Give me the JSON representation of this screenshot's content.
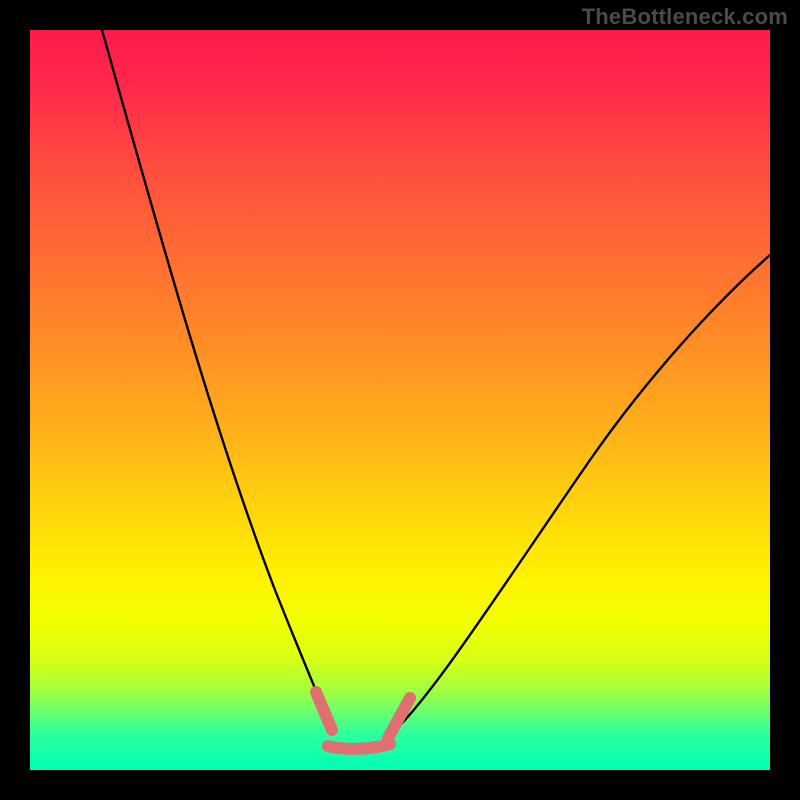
{
  "watermark": "TheBottleneck.com",
  "colors": {
    "page_bg": "#000000",
    "watermark": "#4a4a4a",
    "curve": "#000000",
    "marker": "#e07070",
    "gradient_top": "#ff1a4c",
    "gradient_bottom": "#00ffb4"
  },
  "chart_data": {
    "type": "line",
    "title": "",
    "xlabel": "",
    "ylabel": "",
    "xlim": [
      0,
      100
    ],
    "ylim": [
      0,
      100
    ],
    "grid": false,
    "note": "Axes lack tick labels; values are fractional positions read from pixel geometry. y=0 is bottom (green), y=100 is top (red). The curve is a V-shaped bottleneck profile with its minimum near x≈40–48, y≈4.",
    "series": [
      {
        "name": "bottleneck-curve",
        "x": [
          10,
          15,
          20,
          25,
          30,
          35,
          38,
          40,
          44,
          48,
          52,
          56,
          60,
          66,
          74,
          82,
          90,
          100
        ],
        "y": [
          100,
          82,
          65,
          50,
          36,
          23,
          14,
          8,
          5,
          4,
          6,
          10,
          16,
          24,
          36,
          47,
          56,
          65
        ]
      }
    ],
    "markers": [
      {
        "name": "left-valley-marker",
        "x_range": [
          38,
          41
        ],
        "y_range": [
          7,
          15
        ]
      },
      {
        "name": "right-valley-marker",
        "x_range": [
          48,
          52
        ],
        "y_range": [
          4,
          12
        ]
      },
      {
        "name": "valley-floor-marker",
        "x_range": [
          40,
          50
        ],
        "y_range": [
          3,
          6
        ]
      }
    ]
  }
}
